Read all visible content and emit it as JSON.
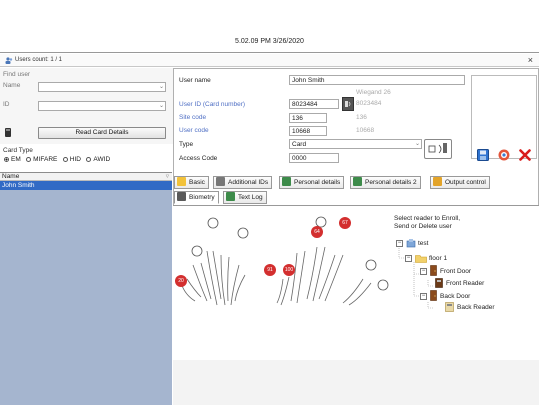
{
  "window": {
    "title": "5.02.09 PM 3/26/2020"
  },
  "info_bar": {
    "text": "Users count: 1 / 1",
    "close_glyph": "×"
  },
  "find_user": {
    "title": "Find user",
    "name_label": "Name",
    "id_label": "ID"
  },
  "card": {
    "read_button": "Read Card Details",
    "type_label": "Card Type",
    "options": [
      "EM",
      "MIFARE",
      "HID",
      "AWID"
    ],
    "selected": "EM"
  },
  "user_list": {
    "header": "Name",
    "rows": [
      "John Smith"
    ]
  },
  "form": {
    "user_name_label": "User name",
    "user_name_value": "John Smith",
    "wiegand_label": "Wiegand 26",
    "user_id_label": "User ID (Card number)",
    "user_id_value": "8023484",
    "user_id_side": "8023484",
    "site_code_label": "Site code",
    "site_code_value": "136",
    "site_code_side": "136",
    "user_code_label": "User code",
    "user_code_value": "10668",
    "user_code_side": "10668",
    "type_label": "Type",
    "type_value": "Card",
    "access_code_label": "Access Code",
    "access_code_value": "0000"
  },
  "tabs_row1": [
    "Basic",
    "Additional IDs",
    "Personal details",
    "Personal details 2",
    "Output control"
  ],
  "tabs_row2": [
    "Biometry",
    "Text Log"
  ],
  "biometry": {
    "instruction": [
      "Select reader to Enroll,",
      "Send or Delete user"
    ],
    "finger_marks": [
      "20",
      "91",
      "100",
      "64",
      "67"
    ],
    "tree": {
      "root": "test",
      "floor": "floor 1",
      "door1": "Front Door",
      "reader1": "Front Reader",
      "door2": "Back Door",
      "reader2": "Back Reader"
    }
  },
  "colors": {
    "selection": "#316ac5",
    "finger_mark": "#d32f2f",
    "list_bg": "#a5b5cf",
    "blue_label": "#4f6fc4"
  }
}
